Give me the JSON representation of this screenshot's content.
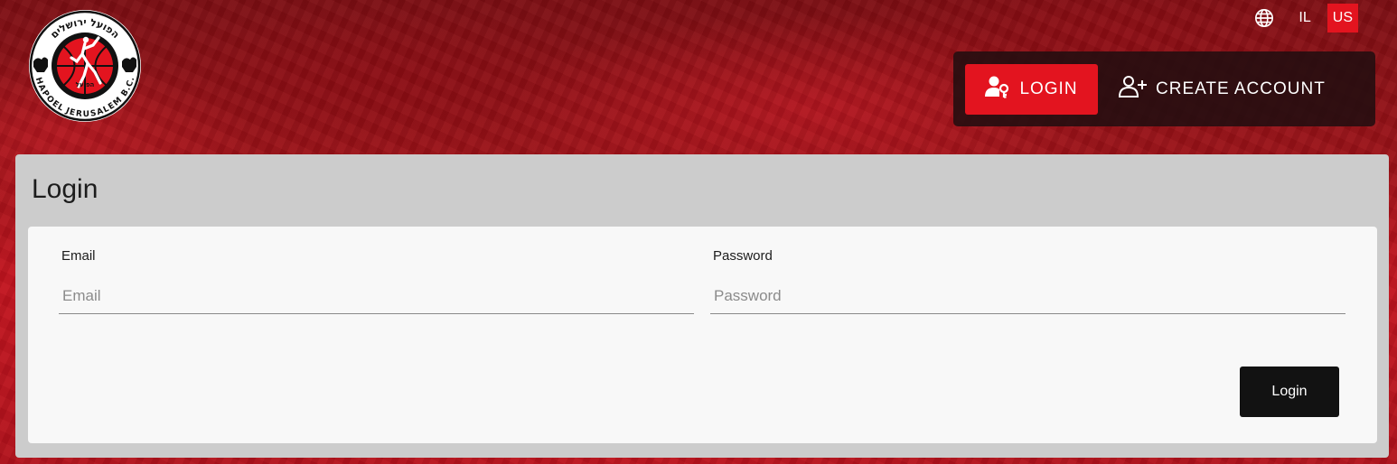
{
  "logo": {
    "hebrew_text": "הפועל ירושלים",
    "english_text": "HAPOEL JERUSALEM B.C.",
    "inner_text": "הפועל"
  },
  "language": {
    "icon": "globe-icon",
    "options": [
      "IL",
      "US"
    ],
    "selected": "US"
  },
  "auth_nav": {
    "login_label": "LOGIN",
    "login_icon": "user-key-icon",
    "create_account_label": "CREATE ACCOUNT",
    "create_account_icon": "user-plus-icon"
  },
  "login_panel": {
    "title": "Login",
    "email": {
      "label": "Email",
      "placeholder": "Email",
      "value": ""
    },
    "password": {
      "label": "Password",
      "placeholder": "Password",
      "value": ""
    },
    "submit_label": "Login"
  },
  "colors": {
    "brand_red": "#e3141f",
    "dark_button": "#121212",
    "panel_bg": "#cccccc",
    "card_bg": "#f8f8f8"
  }
}
